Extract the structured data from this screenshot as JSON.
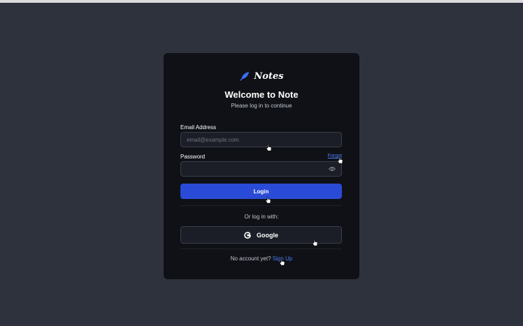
{
  "brand": {
    "name": "Notes",
    "logo_icon": "feather-icon"
  },
  "login": {
    "title": "Welcome to Note",
    "subtitle": "Please log in to continue",
    "email_label": "Email Address",
    "email_placeholder": "email@example.com",
    "email_value": "",
    "password_label": "Password",
    "password_value": "",
    "forgot_label": "Forgot",
    "login_button": "Login",
    "or_text": "Or log in with:",
    "google_button": "Google",
    "no_account_text": "No account yet?",
    "signup_link": "Sign Up"
  },
  "colors": {
    "page_background": "#2e323d",
    "card_background": "#0f1117",
    "accent": "#2a4bd7",
    "link": "#4f7cf6"
  }
}
